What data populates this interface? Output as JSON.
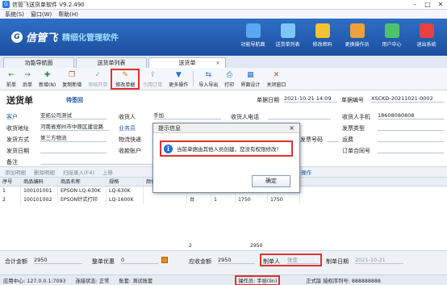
{
  "window": {
    "title": "信管飞送货单软件 V9.2.490"
  },
  "menu": [
    "系统(S)",
    "窗口(W)",
    "帮助(H)"
  ],
  "brand": {
    "logo_mark": "G",
    "name": "信管飞",
    "slogan": "精细化管理软件"
  },
  "topnav": [
    {
      "label": "功能导航面",
      "icon": "monitor-icon",
      "color": "#5aa9f0"
    },
    {
      "label": "送货单列表",
      "icon": "list-icon",
      "color": "#7ec8f8"
    },
    {
      "label": "修改密码",
      "icon": "lock-icon",
      "color": "#f2c230"
    },
    {
      "label": "更换操作员",
      "icon": "user-icon",
      "color": "#f2a03a"
    },
    {
      "label": "用户中心",
      "icon": "globe-icon",
      "color": "#4fc36a"
    },
    {
      "label": "退出系统",
      "icon": "power-icon",
      "color": "#e94040"
    }
  ],
  "tabs": [
    {
      "label": "功能导航面"
    },
    {
      "label": "送货单列表"
    },
    {
      "label": "送货单",
      "close": "×"
    }
  ],
  "toolbar": [
    {
      "label": "前单",
      "icon": "←"
    },
    {
      "label": "后单",
      "icon": "→"
    },
    {
      "label": "新增(N)",
      "icon": "✚"
    },
    {
      "label": "复制新增",
      "icon": "❐"
    },
    {
      "label": "审核开单",
      "icon": "✓"
    },
    {
      "label": "修改单据",
      "icon": "✎"
    },
    {
      "label": "引用订单",
      "icon": "⇪"
    },
    {
      "label": "更多操作",
      "icon": "▼"
    },
    {
      "label": "导入导出",
      "icon": "⇆"
    },
    {
      "label": "打印",
      "icon": "⎙"
    },
    {
      "label": "界面设计",
      "icon": "▦"
    },
    {
      "label": "关闭窗口",
      "icon": "✕"
    }
  ],
  "form": {
    "title": "送货单",
    "status": "待签回",
    "customer_label": "客户",
    "customer": "亚拓公司测试",
    "address_label": "收货地址",
    "address": "河南省郑州市中原区建设路",
    "ship_method_label": "发货方式",
    "ship_method": "第三方物流",
    "ship_date_label": "发货日期",
    "ship_date": "",
    "remark_label": "备注",
    "remark": "",
    "receiver_label": "收货人",
    "receiver": "手加",
    "salesman_label": "业务员",
    "salesman": "张",
    "logistics_label": "物流快递",
    "logistics": "",
    "receipt_account_label": "收款账户",
    "receipt_account": "",
    "receiver_phone_label": "收货人电话",
    "receiver_phone": "",
    "doc_date_label": "单据日期",
    "doc_date": "2021-10-21 14:09",
    "doc_no_label": "单据编号",
    "doc_no": "XSCKD-20211021-0002",
    "contact_phone_label": "收货人手机",
    "contact_phone": "18608080808",
    "invoice_type_label": "发票类型",
    "invoice_type": "",
    "invoice_no_label": "发票号码",
    "invoice_no": "",
    "freight_label": "运费",
    "freight": "",
    "order_no_label": "订单合同号",
    "order_no": ""
  },
  "grid_toolbar": [
    "添加明细",
    "删除明细",
    "扫描录入(F4)",
    "上移",
    "更多操作"
  ],
  "grid": {
    "headers": [
      "序号",
      "商品编码",
      "商品名称",
      "规格",
      "颜色",
      "单位",
      "数量",
      "单价",
      "金额"
    ],
    "rows": [
      [
        "1",
        "100101001",
        "EPSON LQ-630K",
        "LQ-630K",
        "",
        "台",
        "1",
        "1200",
        "1200"
      ],
      [
        "2",
        "100101002",
        "EPSON针式打印",
        "LQ-1600K",
        "",
        "台",
        "1",
        "1750",
        "1750"
      ]
    ],
    "total_qty": "2",
    "total_amount": "2950"
  },
  "footer": {
    "total_label": "合计金额",
    "total": "2950",
    "discount_label": "整单优惠",
    "discount": "0",
    "receivable_label": "应收金额",
    "receivable": "2950",
    "maker_label": "制单人",
    "maker": "张亚",
    "make_date_label": "制单日期",
    "make_date": "2021-10-21"
  },
  "statusbar": {
    "center": "应用中心: 127.0.0.1:7093",
    "connection": "连接状态: 正常",
    "account": "账套: 测试账套",
    "operator": "操作员: 手拾(lin)",
    "license": "正式版 授权序列号: 888888888"
  },
  "dialog": {
    "title": "提示信息",
    "message": "当前单据由其他人员创建，您没有权限修改！",
    "ok": "确定",
    "close": "×"
  },
  "colors": {
    "accent": "#1c4f9f",
    "banner": "#2f6fc6",
    "highlight": "#e03030"
  }
}
